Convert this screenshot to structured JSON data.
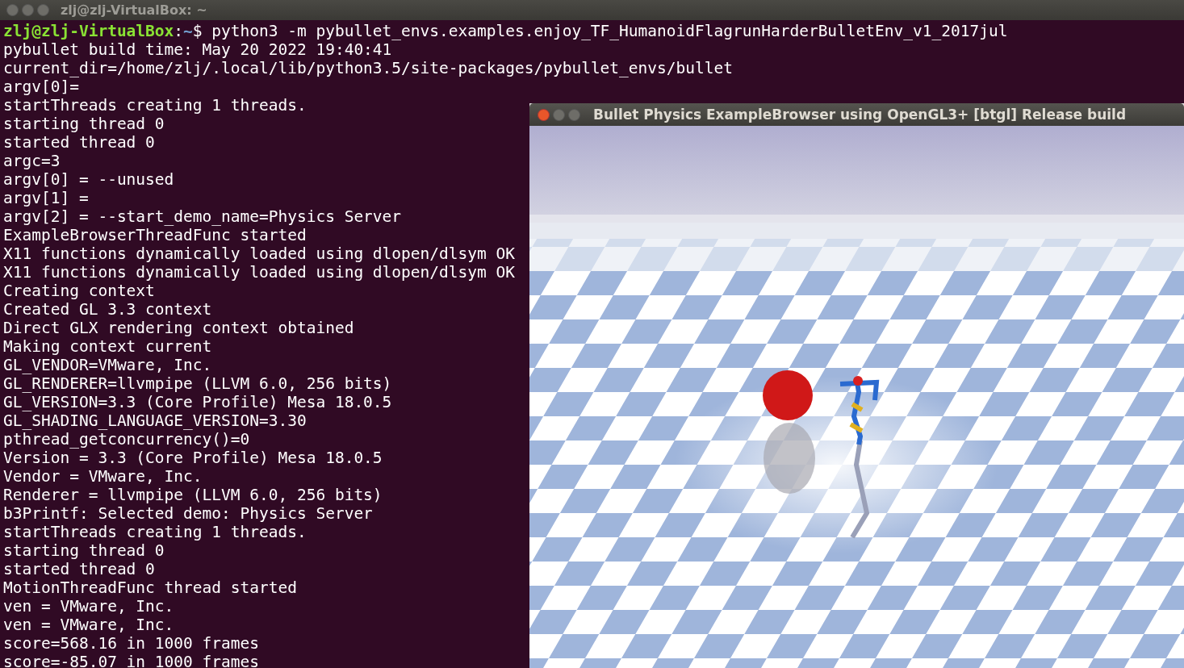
{
  "terminal": {
    "title": "zlj@zlj-VirtualBox: ~",
    "prompt": {
      "user_host": "zlj@zlj-VirtualBox",
      "separator": ":",
      "path": "~",
      "symbol": "$",
      "command": "python3 -m pybullet_envs.examples.enjoy_TF_HumanoidFlagrunHarderBulletEnv_v1_2017jul"
    },
    "lines": [
      "pybullet build time: May 20 2022 19:40:41",
      "current_dir=/home/zlj/.local/lib/python3.5/site-packages/pybullet_envs/bullet",
      "argv[0]=",
      "startThreads creating 1 threads.",
      "starting thread 0",
      "started thread 0",
      "argc=3",
      "argv[0] = --unused",
      "argv[1] = ",
      "argv[2] = --start_demo_name=Physics Server",
      "ExampleBrowserThreadFunc started",
      "X11 functions dynamically loaded using dlopen/dlsym OK",
      "X11 functions dynamically loaded using dlopen/dlsym OK",
      "Creating context",
      "Created GL 3.3 context",
      "Direct GLX rendering context obtained",
      "Making context current",
      "GL_VENDOR=VMware, Inc.",
      "GL_RENDERER=llvmpipe (LLVM 6.0, 256 bits)",
      "GL_VERSION=3.3 (Core Profile) Mesa 18.0.5",
      "GL_SHADING_LANGUAGE_VERSION=3.30",
      "pthread_getconcurrency()=0",
      "Version = 3.3 (Core Profile) Mesa 18.0.5",
      "Vendor = VMware, Inc.",
      "Renderer = llvmpipe (LLVM 6.0, 256 bits)",
      "b3Printf: Selected demo: Physics Server",
      "startThreads creating 1 threads.",
      "starting thread 0",
      "started thread 0",
      "MotionThreadFunc thread started",
      "ven = VMware, Inc.",
      "ven = VMware, Inc.",
      "score=568.16 in 1000 frames",
      "score=-85.07 in 1000 frames"
    ]
  },
  "viewer": {
    "title": "Bullet Physics ExampleBrowser using OpenGL3+ [btgl] Release build"
  }
}
